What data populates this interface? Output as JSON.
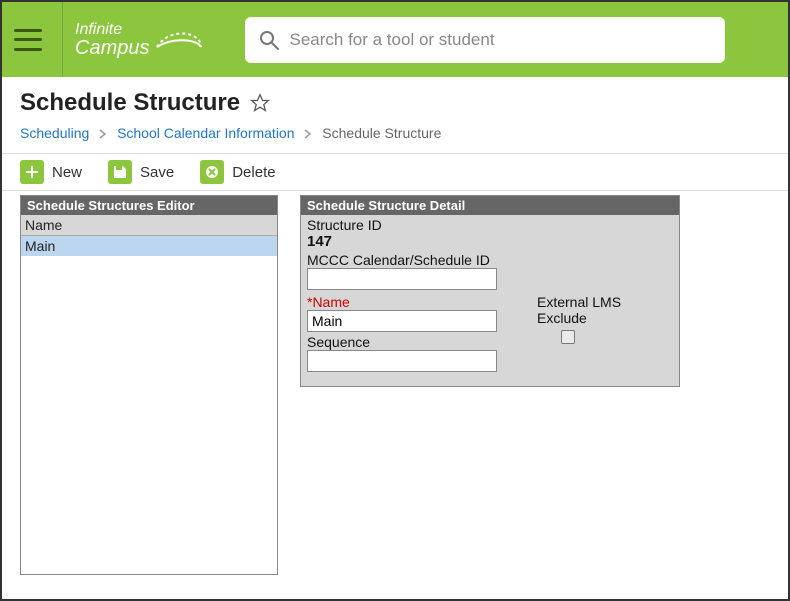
{
  "app": {
    "logo_top": "Infinite",
    "logo_bottom": "Campus"
  },
  "search": {
    "placeholder": "Search for a tool or student"
  },
  "page": {
    "title": "Schedule Structure"
  },
  "breadcrumb": {
    "items": [
      "Scheduling",
      "School Calendar Information",
      "Schedule Structure"
    ]
  },
  "toolbar": {
    "new_label": "New",
    "save_label": "Save",
    "delete_label": "Delete"
  },
  "list_panel": {
    "title": "Schedule Structures Editor",
    "column_header": "Name",
    "rows": [
      "Main"
    ]
  },
  "detail_panel": {
    "title": "Schedule Structure Detail",
    "structure_id_label": "Structure ID",
    "structure_id_value": "147",
    "mccc_label": "MCCC Calendar/Schedule ID",
    "mccc_value": "",
    "name_label": "*Name",
    "name_value": "Main",
    "lms_label": "External LMS Exclude",
    "lms_checked": false,
    "sequence_label": "Sequence",
    "sequence_value": ""
  }
}
